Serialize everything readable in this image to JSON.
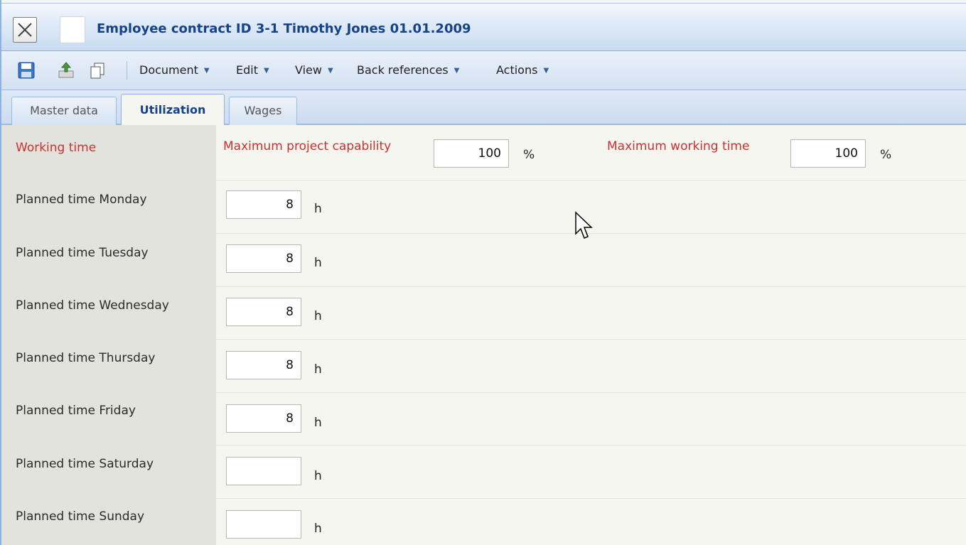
{
  "window": {
    "title": "Employee contract ID 3-1 Timothy Jones 01.01.2009"
  },
  "toolbar": {
    "icons": [
      "save-icon",
      "upload-icon",
      "copy-icon"
    ],
    "menus": [
      "Document",
      "Edit",
      "View",
      "Back references",
      "Actions"
    ]
  },
  "tabs": [
    {
      "label": "Master data",
      "active": false
    },
    {
      "label": "Utilization",
      "active": true
    },
    {
      "label": "Wages",
      "active": false
    }
  ],
  "form": {
    "working_time_label": "Working time",
    "max_project_capability": {
      "label": "Maximum project capability",
      "value": "100",
      "unit": "%"
    },
    "max_working_time": {
      "label": "Maximum working time",
      "value": "100",
      "unit": "%"
    },
    "planned": [
      {
        "label": "Planned time Monday",
        "value": "8",
        "unit": "h"
      },
      {
        "label": "Planned time Tuesday",
        "value": "8",
        "unit": "h"
      },
      {
        "label": "Planned time Wednesday",
        "value": "8",
        "unit": "h"
      },
      {
        "label": "Planned time Thursday",
        "value": "8",
        "unit": "h"
      },
      {
        "label": "Planned time Friday",
        "value": "8",
        "unit": "h"
      },
      {
        "label": "Planned time Saturday",
        "value": "",
        "unit": "h"
      },
      {
        "label": "Planned time Sunday",
        "value": "",
        "unit": "h"
      }
    ]
  },
  "colors": {
    "title_text": "#15428b",
    "required_label": "#c9312f",
    "label_column_bg": "#e3e3de",
    "form_bg": "#f6f6f1"
  }
}
